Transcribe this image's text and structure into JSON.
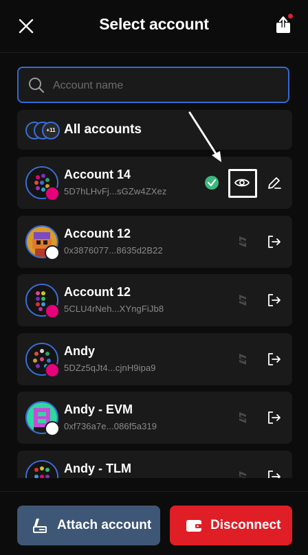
{
  "header": {
    "title": "Select account",
    "close_icon": "close-icon",
    "share_icon": "share-icon",
    "notification_color": "#e0202f"
  },
  "search": {
    "placeholder": "Account name",
    "value": ""
  },
  "all_accounts": {
    "label": "All accounts",
    "count_badge": "+11"
  },
  "accounts": [
    {
      "name": "Account 14",
      "address": "5D7hLHvFj...sGZw4ZXez",
      "network": "polkadot",
      "selected": true
    },
    {
      "name": "Account 12",
      "address": "0x3876077...8635d2B22",
      "network": "ethereum",
      "selected": false
    },
    {
      "name": "Account 12",
      "address": "5CLU4rNeh...XYngFiJb8",
      "network": "polkadot",
      "selected": false
    },
    {
      "name": "Andy",
      "address": "5DZz5qJt4...cjnH9ipa9",
      "network": "polkadot",
      "selected": false
    },
    {
      "name": "Andy - EVM",
      "address": "0xf736a7e...086f5a319",
      "network": "ethereum",
      "selected": false
    },
    {
      "name": "Andy - TLM",
      "address": "",
      "network": "polkadot",
      "selected": false
    }
  ],
  "footer": {
    "attach_label": "Attach account",
    "disconnect_label": "Disconnect"
  },
  "colors": {
    "accent": "#2f6bd8",
    "attach": "#3f5776",
    "disconnect": "#e01e26",
    "check": "#3bb87d"
  }
}
